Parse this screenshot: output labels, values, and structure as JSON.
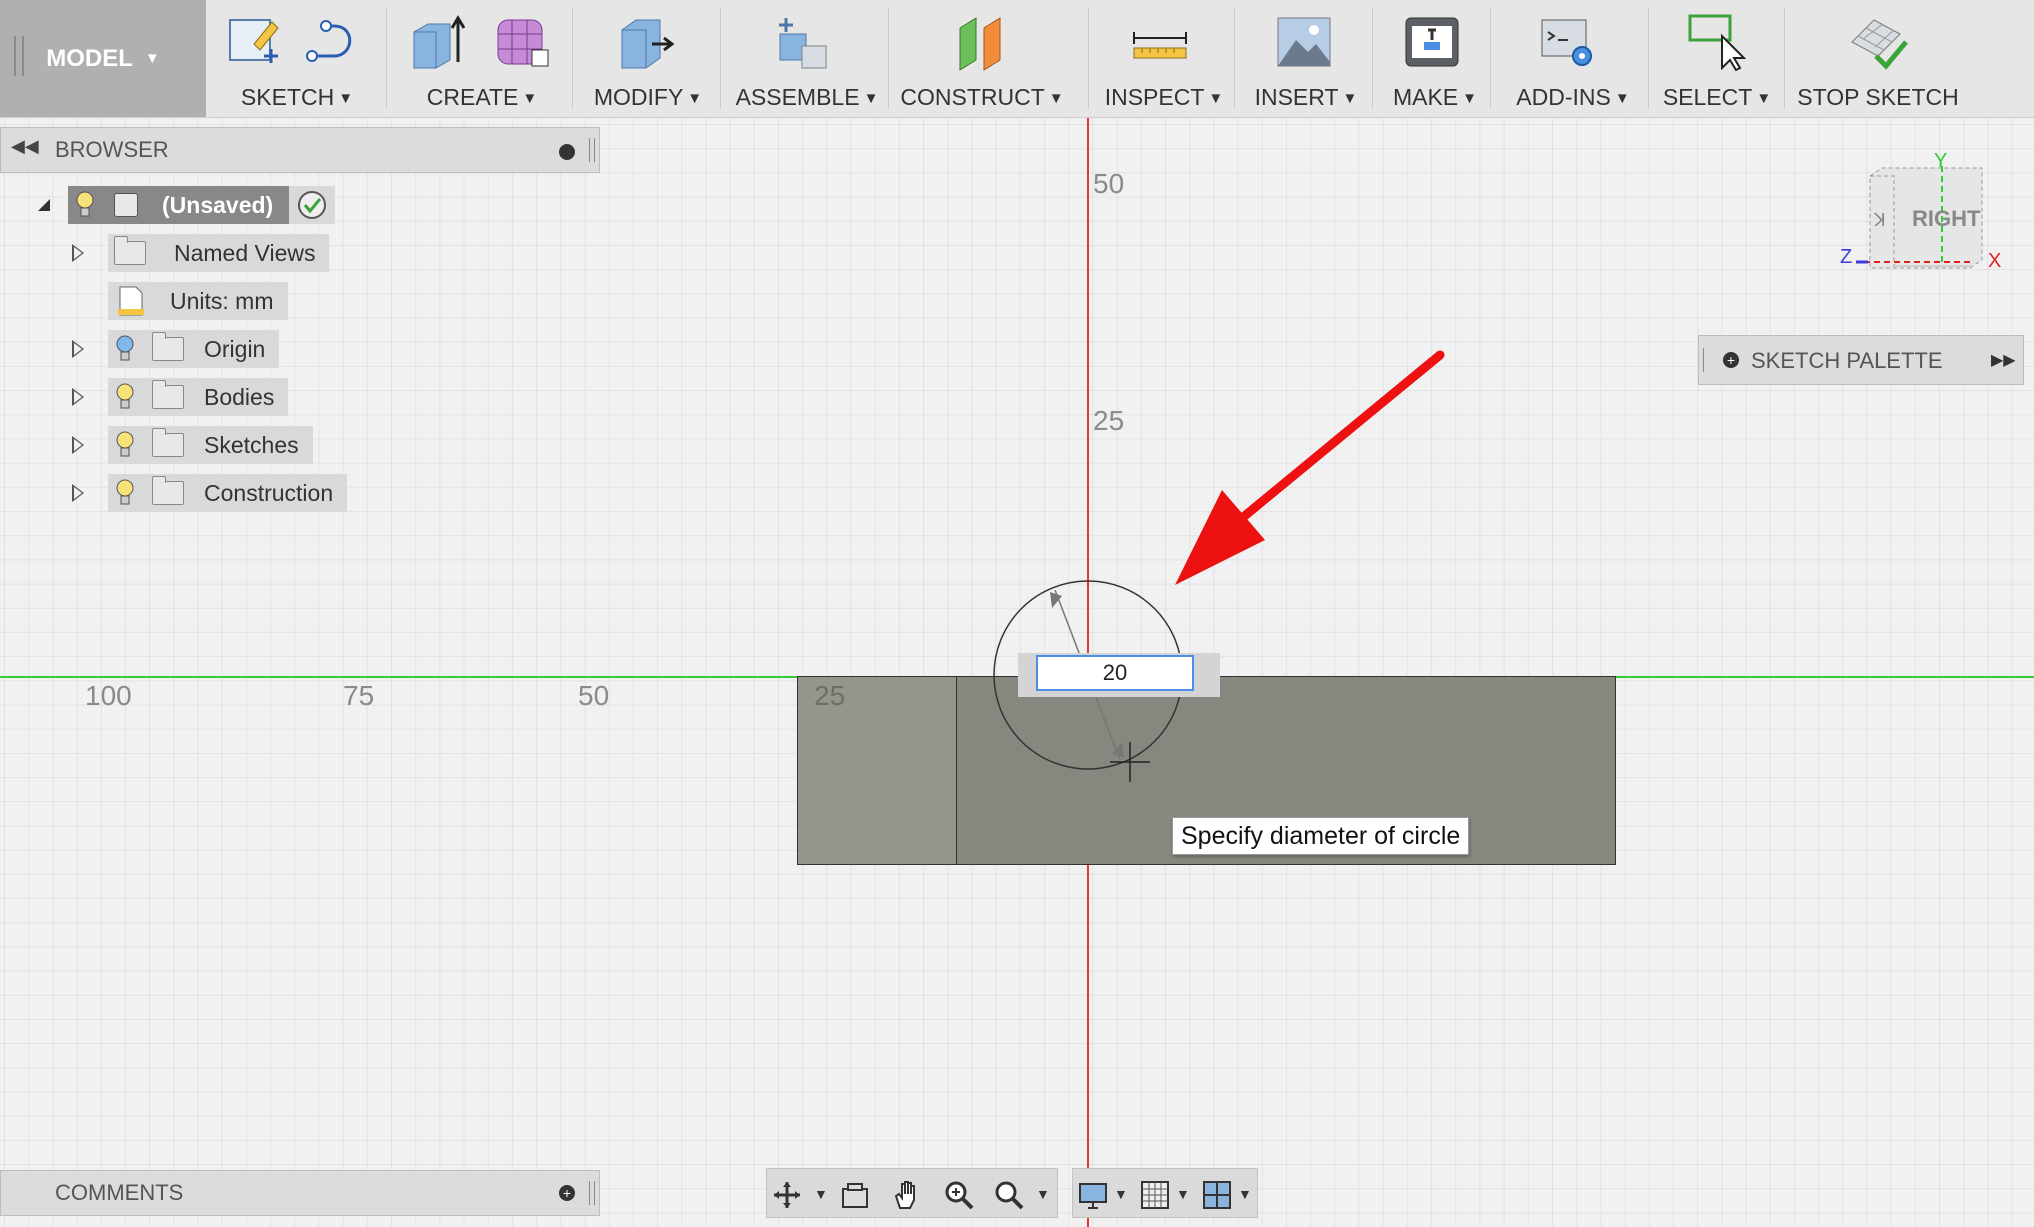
{
  "toolbar": {
    "workspace_label": "MODEL",
    "groups": [
      {
        "label": "SKETCH"
      },
      {
        "label": "CREATE"
      },
      {
        "label": "MODIFY"
      },
      {
        "label": "ASSEMBLE"
      },
      {
        "label": "CONSTRUCT"
      },
      {
        "label": "INSPECT"
      },
      {
        "label": "INSERT"
      },
      {
        "label": "MAKE"
      },
      {
        "label": "ADD-INS"
      },
      {
        "label": "SELECT"
      },
      {
        "label": "STOP SKETCH"
      }
    ]
  },
  "browser": {
    "title": "BROWSER",
    "root_label": "(Unsaved)",
    "items": [
      {
        "label": "Named Views",
        "icon": "folder-icon"
      },
      {
        "label": "Units: mm",
        "icon": "document-icon"
      },
      {
        "label": "Origin",
        "icon": "folder-icon"
      },
      {
        "label": "Bodies",
        "icon": "folder-icon"
      },
      {
        "label": "Sketches",
        "icon": "folder-icon"
      },
      {
        "label": "Construction",
        "icon": "folder-icon"
      }
    ]
  },
  "viewcube": {
    "face_label": "RIGHT",
    "axis_x": "X",
    "axis_y": "Y",
    "axis_z": "Z"
  },
  "sketch_palette": {
    "title": "SKETCH PALETTE"
  },
  "canvas": {
    "vertical_ruler": [
      "50",
      "25"
    ],
    "horizontal_ruler": [
      "100",
      "75",
      "50",
      "25"
    ],
    "diameter_input_value": "20",
    "tooltip": "Specify diameter of circle"
  },
  "comments": {
    "title": "COMMENTS"
  },
  "colors": {
    "x_axis_line": "#2ecc40",
    "y_axis_line": "#e02020",
    "annotation_arrow": "#ee1111",
    "body_fill": "#868880"
  }
}
